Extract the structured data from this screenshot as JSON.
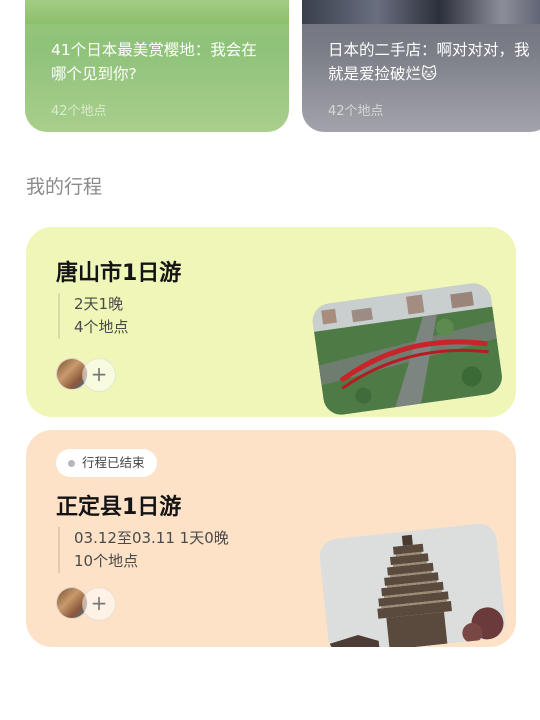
{
  "collections": [
    {
      "title": "41个日本最美赏樱地：我会在哪个见到你?",
      "count": "42个地点"
    },
    {
      "title": "日本的二手店：啊对对对，我就是爱捡破烂🐱",
      "count": "42个地点"
    }
  ],
  "section_title": "我的行程",
  "trips": [
    {
      "title": "唐山市1日游",
      "duration": "2天1晚",
      "places": "4个地点",
      "add_icon": "+",
      "photo": "city-aerial-red-arch-bridge"
    },
    {
      "status": "行程已结束",
      "title": "正定县1日游",
      "duration": "03.12至03.11 1天0晚",
      "places": "10个地点",
      "add_icon": "+",
      "photo": "ancient-pagoda"
    }
  ]
}
